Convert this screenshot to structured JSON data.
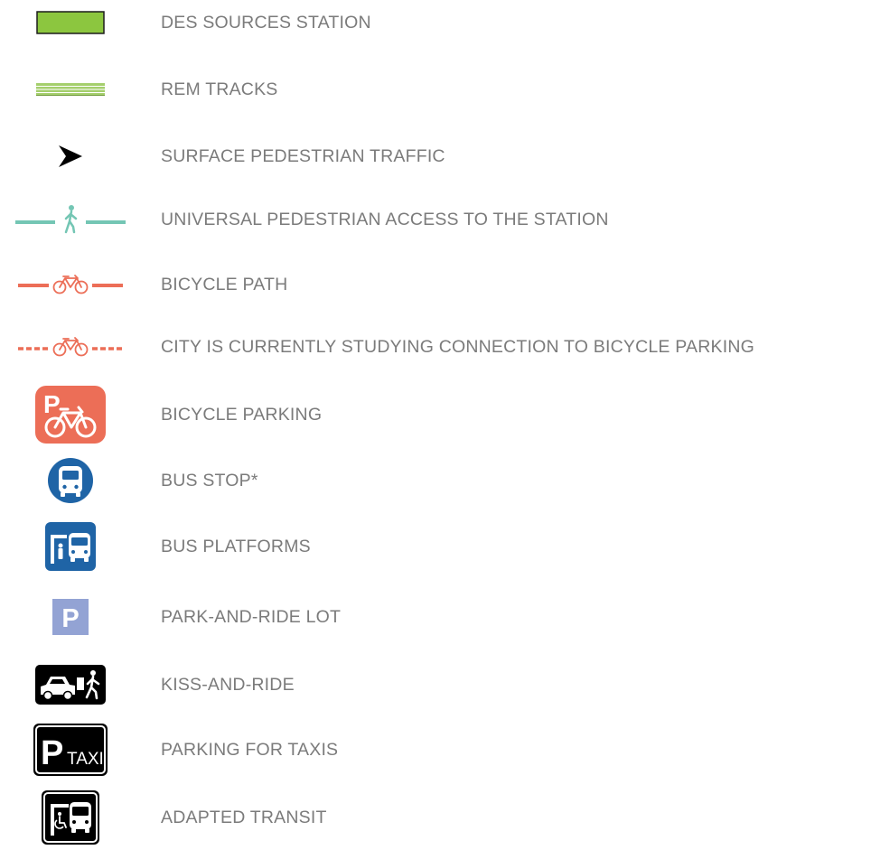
{
  "legend": {
    "items": [
      {
        "icon": "green-rectangle-icon",
        "label": "DES SOURCES STATION"
      },
      {
        "icon": "rail-tracks-icon",
        "label": "REM TRACKS"
      },
      {
        "icon": "arrowhead-icon",
        "label": "SURFACE PEDESTRIAN TRAFFIC"
      },
      {
        "icon": "pedestrian-line-icon",
        "label": "UNIVERSAL PEDESTRIAN ACCESS TO THE STATION"
      },
      {
        "icon": "bicycle-solid-line-icon",
        "label": "BICYCLE PATH"
      },
      {
        "icon": "bicycle-dashed-line-icon",
        "label": "CITY IS CURRENTLY STUDYING CONNECTION TO BICYCLE PARKING"
      },
      {
        "icon": "bicycle-parking-icon",
        "label": "BICYCLE PARKING",
        "glyph": "P"
      },
      {
        "icon": "bus-stop-icon",
        "label": "BUS STOP*"
      },
      {
        "icon": "bus-platform-icon",
        "label": "BUS PLATFORMS"
      },
      {
        "icon": "park-and-ride-icon",
        "label": "PARK-AND-RIDE LOT",
        "glyph": "P"
      },
      {
        "icon": "kiss-and-ride-icon",
        "label": "KISS-AND-RIDE"
      },
      {
        "icon": "taxi-parking-icon",
        "label": "PARKING FOR TAXIS",
        "glyph": "P",
        "glyph_sub": "TAXI"
      },
      {
        "icon": "adapted-transit-icon",
        "label": "ADAPTED TRANSIT"
      }
    ]
  },
  "colors": {
    "label_text": "#7b7b7b",
    "station_green": "#8cc63f",
    "track_green": "#a5cf6d",
    "pedestrian_teal": "#74c6b4",
    "bicycle_coral": "#ec6e57",
    "transit_blue": "#1f64a6",
    "parking_lavender": "#93a3d4",
    "black": "#000000"
  }
}
